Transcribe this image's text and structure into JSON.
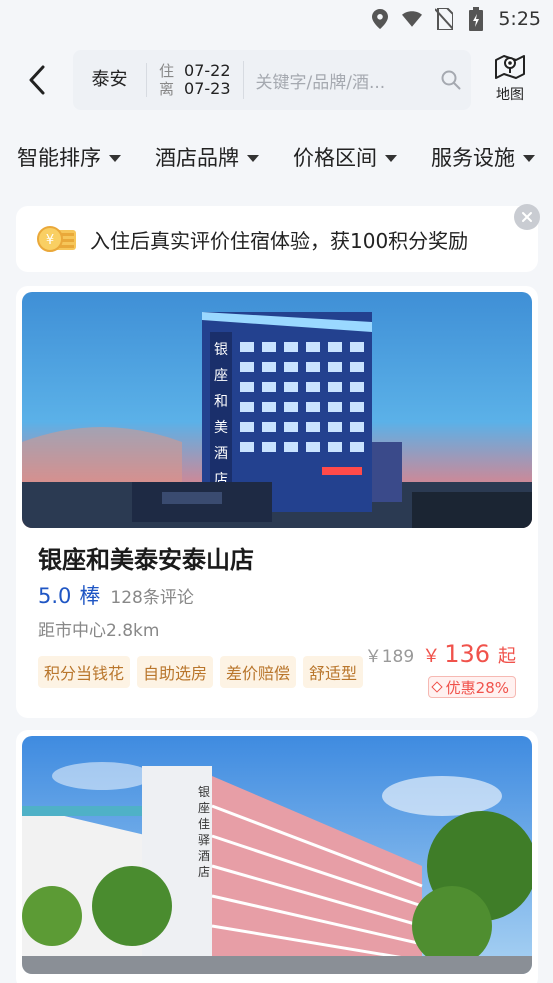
{
  "status_bar": {
    "time": "5:25",
    "icons": [
      "location-icon",
      "wifi-icon",
      "no-sim-icon",
      "battery-icon"
    ]
  },
  "header": {
    "city": "泰安",
    "checkin_label": "住",
    "checkout_label": "离",
    "checkin_date": "07-22",
    "checkout_date": "07-23",
    "keyword_placeholder": "关键字/品牌/酒...",
    "map_label": "地图"
  },
  "filters": [
    {
      "label": "智能排序"
    },
    {
      "label": "酒店品牌"
    },
    {
      "label": "价格区间"
    },
    {
      "label": "服务设施"
    }
  ],
  "promo": {
    "text": "入住后真实评价住宿体验，获100积分奖励"
  },
  "hotels": [
    {
      "name": "银座和美泰安泰山店",
      "score": "5.0",
      "score_word": "棒",
      "reviews": "128条评论",
      "distance": "距市中心2.8km",
      "tags": [
        "积分当钱花",
        "自助选房",
        "差价赔偿",
        "舒适型"
      ],
      "original_price": "￥189",
      "currency": "￥",
      "price": "136",
      "price_suffix": "起",
      "discount": "优惠28%",
      "photo_sign": "银座和美酒店"
    },
    {
      "name": "",
      "photo_sign": "银座佳驿酒店"
    }
  ],
  "colors": {
    "accent_blue": "#1f56c4",
    "price_red": "#f0524b",
    "tag_bg": "#fdf3e4",
    "tag_text": "#b9762c"
  }
}
